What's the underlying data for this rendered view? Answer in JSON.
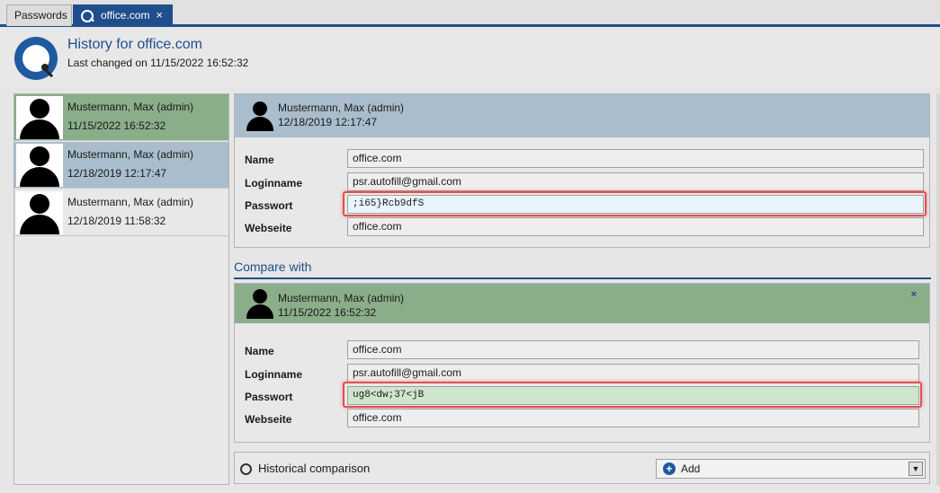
{
  "tabs": [
    {
      "label": "Passwords"
    },
    {
      "label": "office.com",
      "close": "×"
    }
  ],
  "header": {
    "title": "History for office.com",
    "subtitle": "Last changed on 11/15/2022 16:52:32"
  },
  "history": [
    {
      "name": "Mustermann, Max (admin)",
      "date": "11/15/2022 16:52:32",
      "state": "selected"
    },
    {
      "name": "Mustermann, Max (admin)",
      "date": "12/18/2019 12:17:47",
      "state": "hover"
    },
    {
      "name": "Mustermann, Max (admin)",
      "date": "12/18/2019 11:58:32",
      "state": "normal"
    }
  ],
  "current": {
    "user": "Mustermann, Max (admin)",
    "date": "12/18/2019 12:17:47",
    "fields": {
      "name_label": "Name",
      "name_value": "office.com",
      "login_label": "Loginname",
      "login_value": "psr.autofill@gmail.com",
      "pw_label": "Passwort",
      "pw_value": ";i65}Rcb9dfS",
      "web_label": "Webseite",
      "web_value": "office.com"
    }
  },
  "compare": {
    "section_title": "Compare with",
    "close": "×",
    "user": "Mustermann, Max (admin)",
    "date": "11/15/2022 16:52:32",
    "fields": {
      "name_label": "Name",
      "name_value": "office.com",
      "login_label": "Loginname",
      "login_value": "psr.autofill@gmail.com",
      "pw_label": "Passwort",
      "pw_value": "ug8<dw;37<jB",
      "web_label": "Webseite",
      "web_value": "office.com"
    }
  },
  "bottom": {
    "label": "Historical comparison",
    "dropdown_value": "Add",
    "dropdown_icon": "plus-circle-icon"
  },
  "colors": {
    "accent": "#1f4e8c",
    "selected_green": "#8aad8a",
    "hover_blue": "#a9bdcc",
    "highlight_red": "#e35050"
  }
}
